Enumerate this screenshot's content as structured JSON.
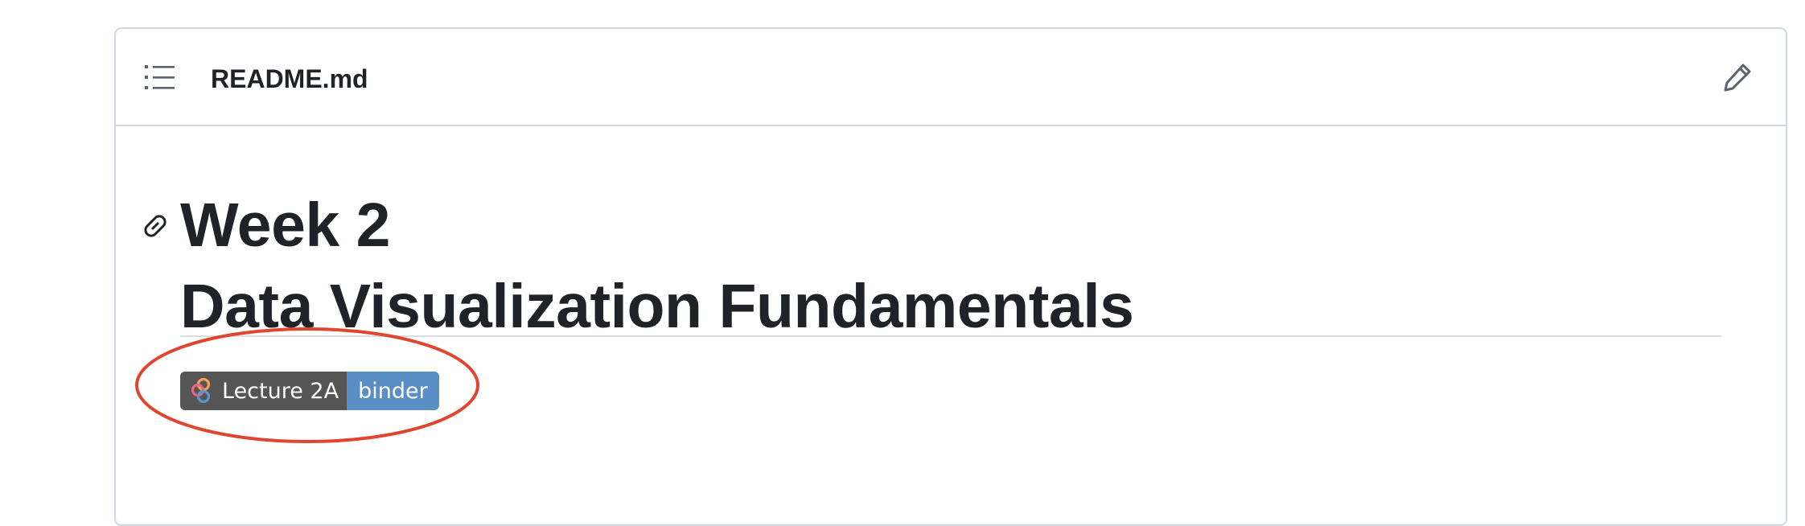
{
  "readme": {
    "filename": "README.md",
    "heading_line1": "Week 2",
    "heading_line2": "Data Visualization Fundamentals"
  },
  "badge": {
    "left_label": "Lecture 2A",
    "right_label": "binder",
    "left_color": "#555555",
    "right_color": "#5a8fc5"
  },
  "icons": {
    "toc": "list-unordered-icon",
    "edit": "pencil-icon",
    "anchor": "link-icon",
    "badge_logo": "binder-logo-icon"
  },
  "colors": {
    "text": "#1f2328",
    "border": "#d0d7de",
    "highlight": "#e0452f"
  }
}
